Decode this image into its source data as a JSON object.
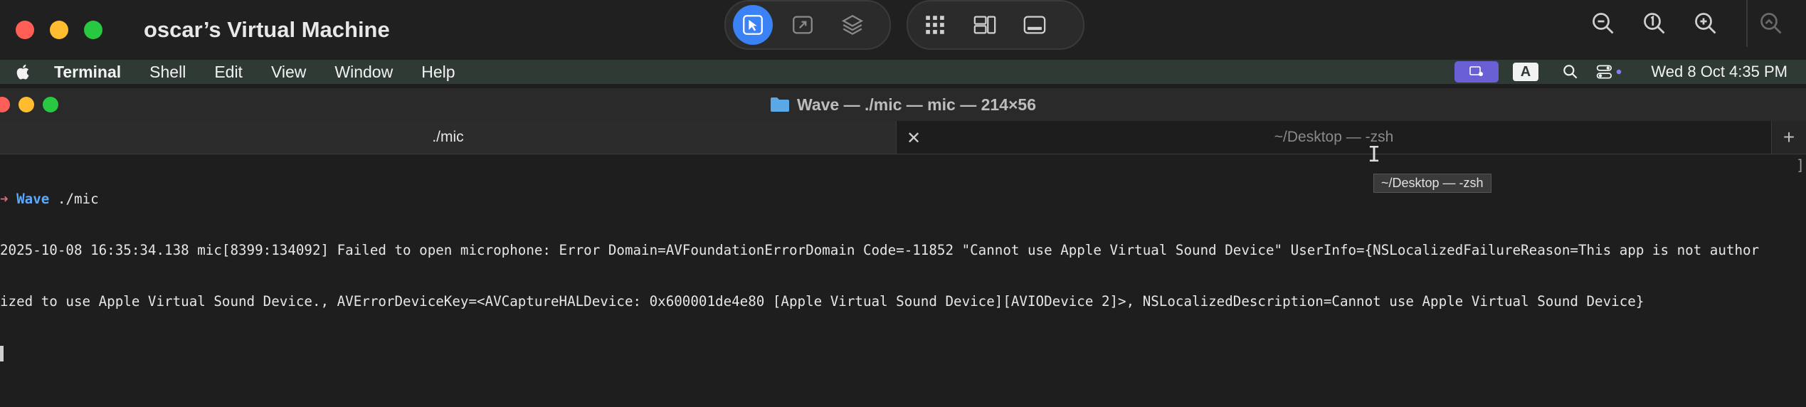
{
  "vm": {
    "title": "oscar’s Virtual Machine"
  },
  "menubar": {
    "app": "Terminal",
    "items": [
      "Shell",
      "Edit",
      "View",
      "Window",
      "Help"
    ],
    "input_badge": "A",
    "clock": "Wed 8 Oct  4:35 PM"
  },
  "window": {
    "title": "Wave — ./mic — mic — 214×56",
    "tabs": [
      {
        "label": "./mic"
      },
      {
        "label": "~/Desktop — -zsh"
      }
    ],
    "tooltip": "~/Desktop — -zsh"
  },
  "terminal": {
    "prompt_arrow": "➜",
    "prompt_dir": "Wave",
    "command": " ./mic",
    "line1": "2025-10-08 16:35:34.138 mic[8399:134092] Failed to open microphone: Error Domain=AVFoundationErrorDomain Code=-11852 \"Cannot use Apple Virtual Sound Device\" UserInfo={NSLocalizedFailureReason=This app is not author",
    "line2": "ized to use Apple Virtual Sound Device., AVErrorDeviceKey=<AVCaptureHALDevice: 0x600001de4e80 [Apple Virtual Sound Device][AVIODevice 2]>, NSLocalizedDescription=Cannot use Apple Virtual Sound Device}",
    "scroll_mark": "]"
  },
  "colors": {
    "accent": "#3b82f6",
    "menubar_bg": "#2f3a35",
    "prompt_arrow": "#e06c75",
    "prompt_dir": "#5aa9ff"
  },
  "icons": {
    "pointer": "cursor-pointer-icon",
    "resize": "resize-screen-icon",
    "layers": "layers-icon",
    "grid": "grid-icon",
    "layout": "window-layout-icon",
    "display": "display-icon",
    "zoom_out": "zoom-out-icon",
    "zoom_reset": "zoom-actual-icon",
    "zoom_in": "zoom-in-icon",
    "zoom_fit": "zoom-fit-icon"
  }
}
